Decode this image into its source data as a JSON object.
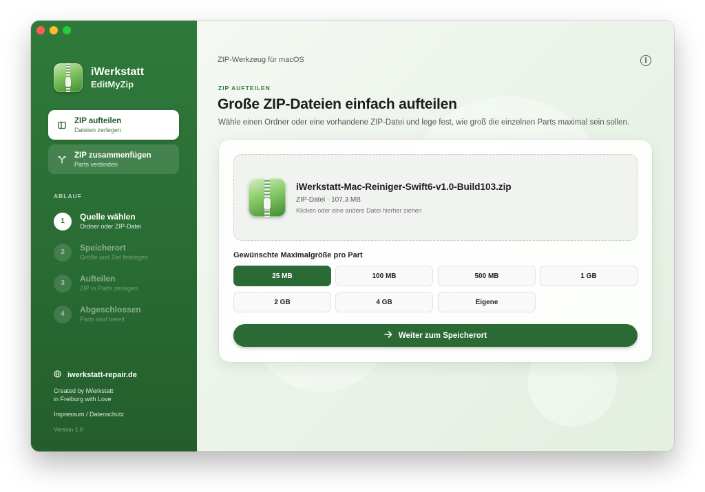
{
  "app": {
    "name": "iWerkstatt",
    "product": "EditMyZip"
  },
  "sidebar": {
    "nav": [
      {
        "label": "ZIP aufteilen",
        "sub": "Dateien zerlegen",
        "active": true,
        "icon": "split-icon"
      },
      {
        "label": "ZIP zusammenfügen",
        "sub": "Parts verbinden",
        "active": false,
        "icon": "merge-icon"
      }
    ],
    "workflow_heading": "ABLAUF",
    "steps": [
      {
        "num": "1",
        "title": "Quelle wählen",
        "sub": "Ordner oder ZIP-Datei",
        "active": true
      },
      {
        "num": "2",
        "title": "Speicherort",
        "sub": "Größe und Ziel festlegen",
        "active": false
      },
      {
        "num": "3",
        "title": "Aufteilen",
        "sub": "ZIP in Parts zerlegen",
        "active": false
      },
      {
        "num": "4",
        "title": "Abgeschlossen",
        "sub": "Parts sind bereit",
        "active": false
      }
    ],
    "website": "iwerkstatt-repair.de",
    "credits_line1": "Created by iWerkstatt",
    "credits_line2": "in Freiburg with Love",
    "legal": "Impressum / Datenschutz",
    "version": "Version 1.0"
  },
  "main": {
    "topbar_title": "ZIP-Werkzeug für macOS",
    "eyebrow": "ZIP AUFTEILEN",
    "headline": "Große ZIP-Dateien einfach aufteilen",
    "subline": "Wähle einen Ordner oder eine vorhandene ZIP-Datei und lege fest, wie groß die einzelnen Parts maximal sein sollen.",
    "file": {
      "name": "iWerkstatt-Mac-Reiniger-Swift6-v1.0-Build103.zip",
      "meta": "ZIP-Datei · 107,3 MB",
      "hint": "Klicken oder eine andere Datei hierher ziehen"
    },
    "size_label": "Gewünschte Maximalgröße pro Part",
    "sizes": [
      "25 MB",
      "100 MB",
      "500 MB",
      "1 GB",
      "2 GB",
      "4 GB",
      "Eigene"
    ],
    "selected_size": "25 MB",
    "cta_label": "Weiter zum Speicherort"
  },
  "colors": {
    "accent": "#2c6a35",
    "sidebar": "#2a6e35"
  }
}
